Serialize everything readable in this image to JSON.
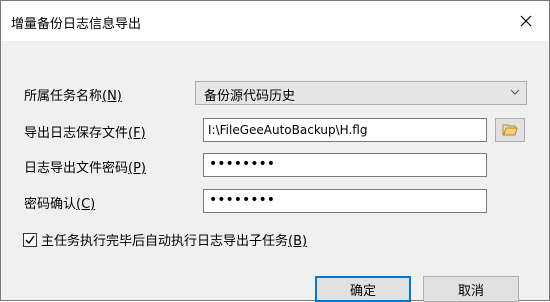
{
  "window": {
    "title": "增量备份日志信息导出",
    "close_icon": "close-icon"
  },
  "form": {
    "task_name_label": "所属任务名称",
    "task_name_accel": "(N)",
    "task_name_value": "备份源代码历史",
    "log_file_label": "导出日志保存文件",
    "log_file_accel": "(F)",
    "log_file_value": "I:\\FileGeeAutoBackup\\H.flg",
    "password_label": "日志导出文件密码",
    "password_accel": "(P)",
    "password_value": "••••••••",
    "confirm_label": "密码确认",
    "confirm_accel": "(C)",
    "confirm_value": "••••••••",
    "auto_export_label": "主任务执行完毕后自动执行日志导出子任务",
    "auto_export_accel": "(B)",
    "auto_export_checked": true
  },
  "buttons": {
    "ok": "确定",
    "cancel": "取消"
  },
  "colors": {
    "accent": "#0078d7",
    "folder_icon": "#e8b830"
  }
}
